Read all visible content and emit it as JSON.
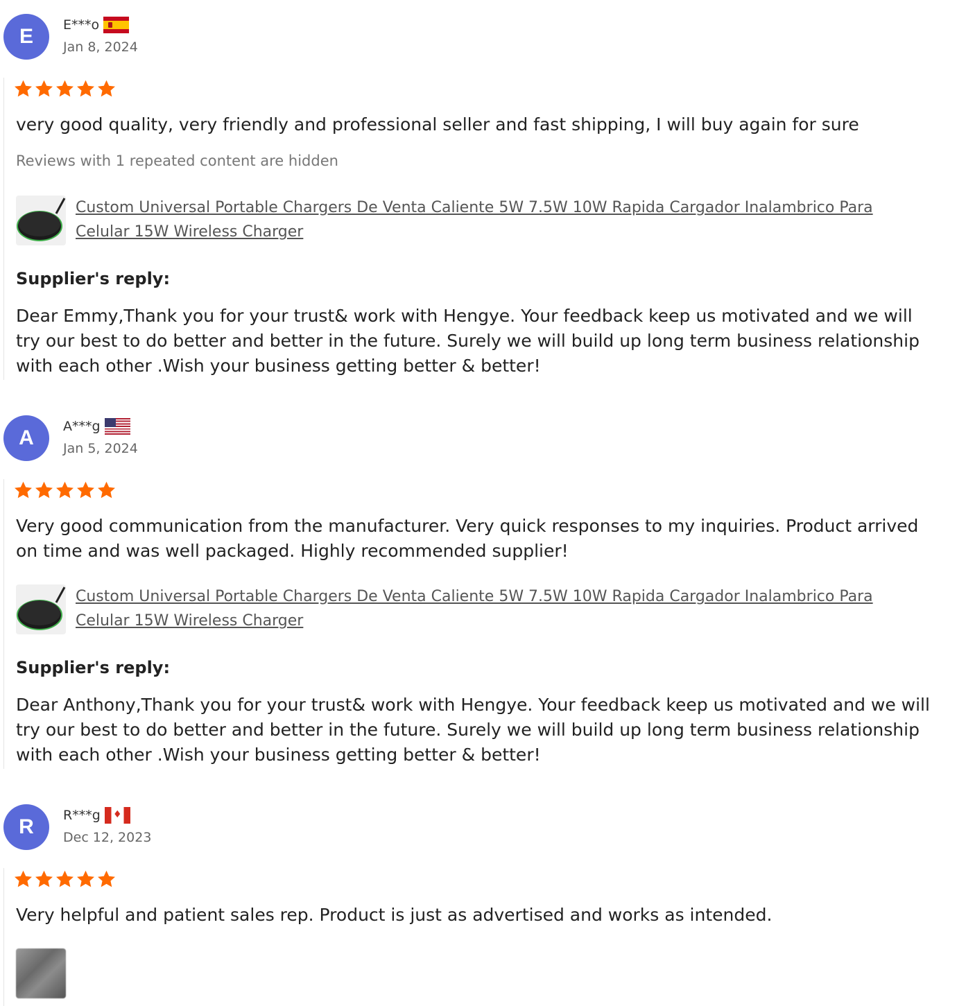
{
  "reviews": [
    {
      "initial": "E",
      "name": "E***o",
      "flag": "spain-flag",
      "date": "Jan 8, 2024",
      "rating": 5,
      "text": "very good quality, very friendly and professional seller and fast shipping, I will buy again for sure",
      "hidden_note": "Reviews with 1 repeated content are hidden",
      "product": "Custom Universal Portable Chargers De Venta Caliente 5W 7.5W 10W Rapida Cargador Inalambrico Para Celular 15W Wireless Charger",
      "reply_title": "Supplier's reply:",
      "reply": "Dear Emmy,Thank you for your trust& work with Hengye. Your feedback keep us motivated and we will try our best to do better and better in the future. Surely we will build up long term business relationship with each other .Wish your business getting better & better!"
    },
    {
      "initial": "A",
      "name": "A***g",
      "flag": "usa-flag",
      "date": "Jan 5, 2024",
      "rating": 5,
      "text": "Very good communication from the manufacturer. Very quick responses to my inquiries. Product arrived on time and was well packaged. Highly recommended supplier!",
      "product": "Custom Universal Portable Chargers De Venta Caliente 5W 7.5W 10W Rapida Cargador Inalambrico Para Celular 15W Wireless Charger",
      "reply_title": "Supplier's reply:",
      "reply": "Dear Anthony,Thank you for your trust& work with Hengye. Your feedback keep us motivated and we will try our best to do better and better in the future. Surely we will build up long term business relationship with each other .Wish your business getting better & better!"
    },
    {
      "initial": "R",
      "name": "R***g",
      "flag": "canada-flag",
      "date": "Dec 12, 2023",
      "rating": 5,
      "text": "Very helpful and patient sales rep. Product is just as advertised and works as intended."
    }
  ],
  "colors": {
    "avatar": "#5a6ad9",
    "star": "#ff6a00",
    "muted_text": "#666666"
  }
}
